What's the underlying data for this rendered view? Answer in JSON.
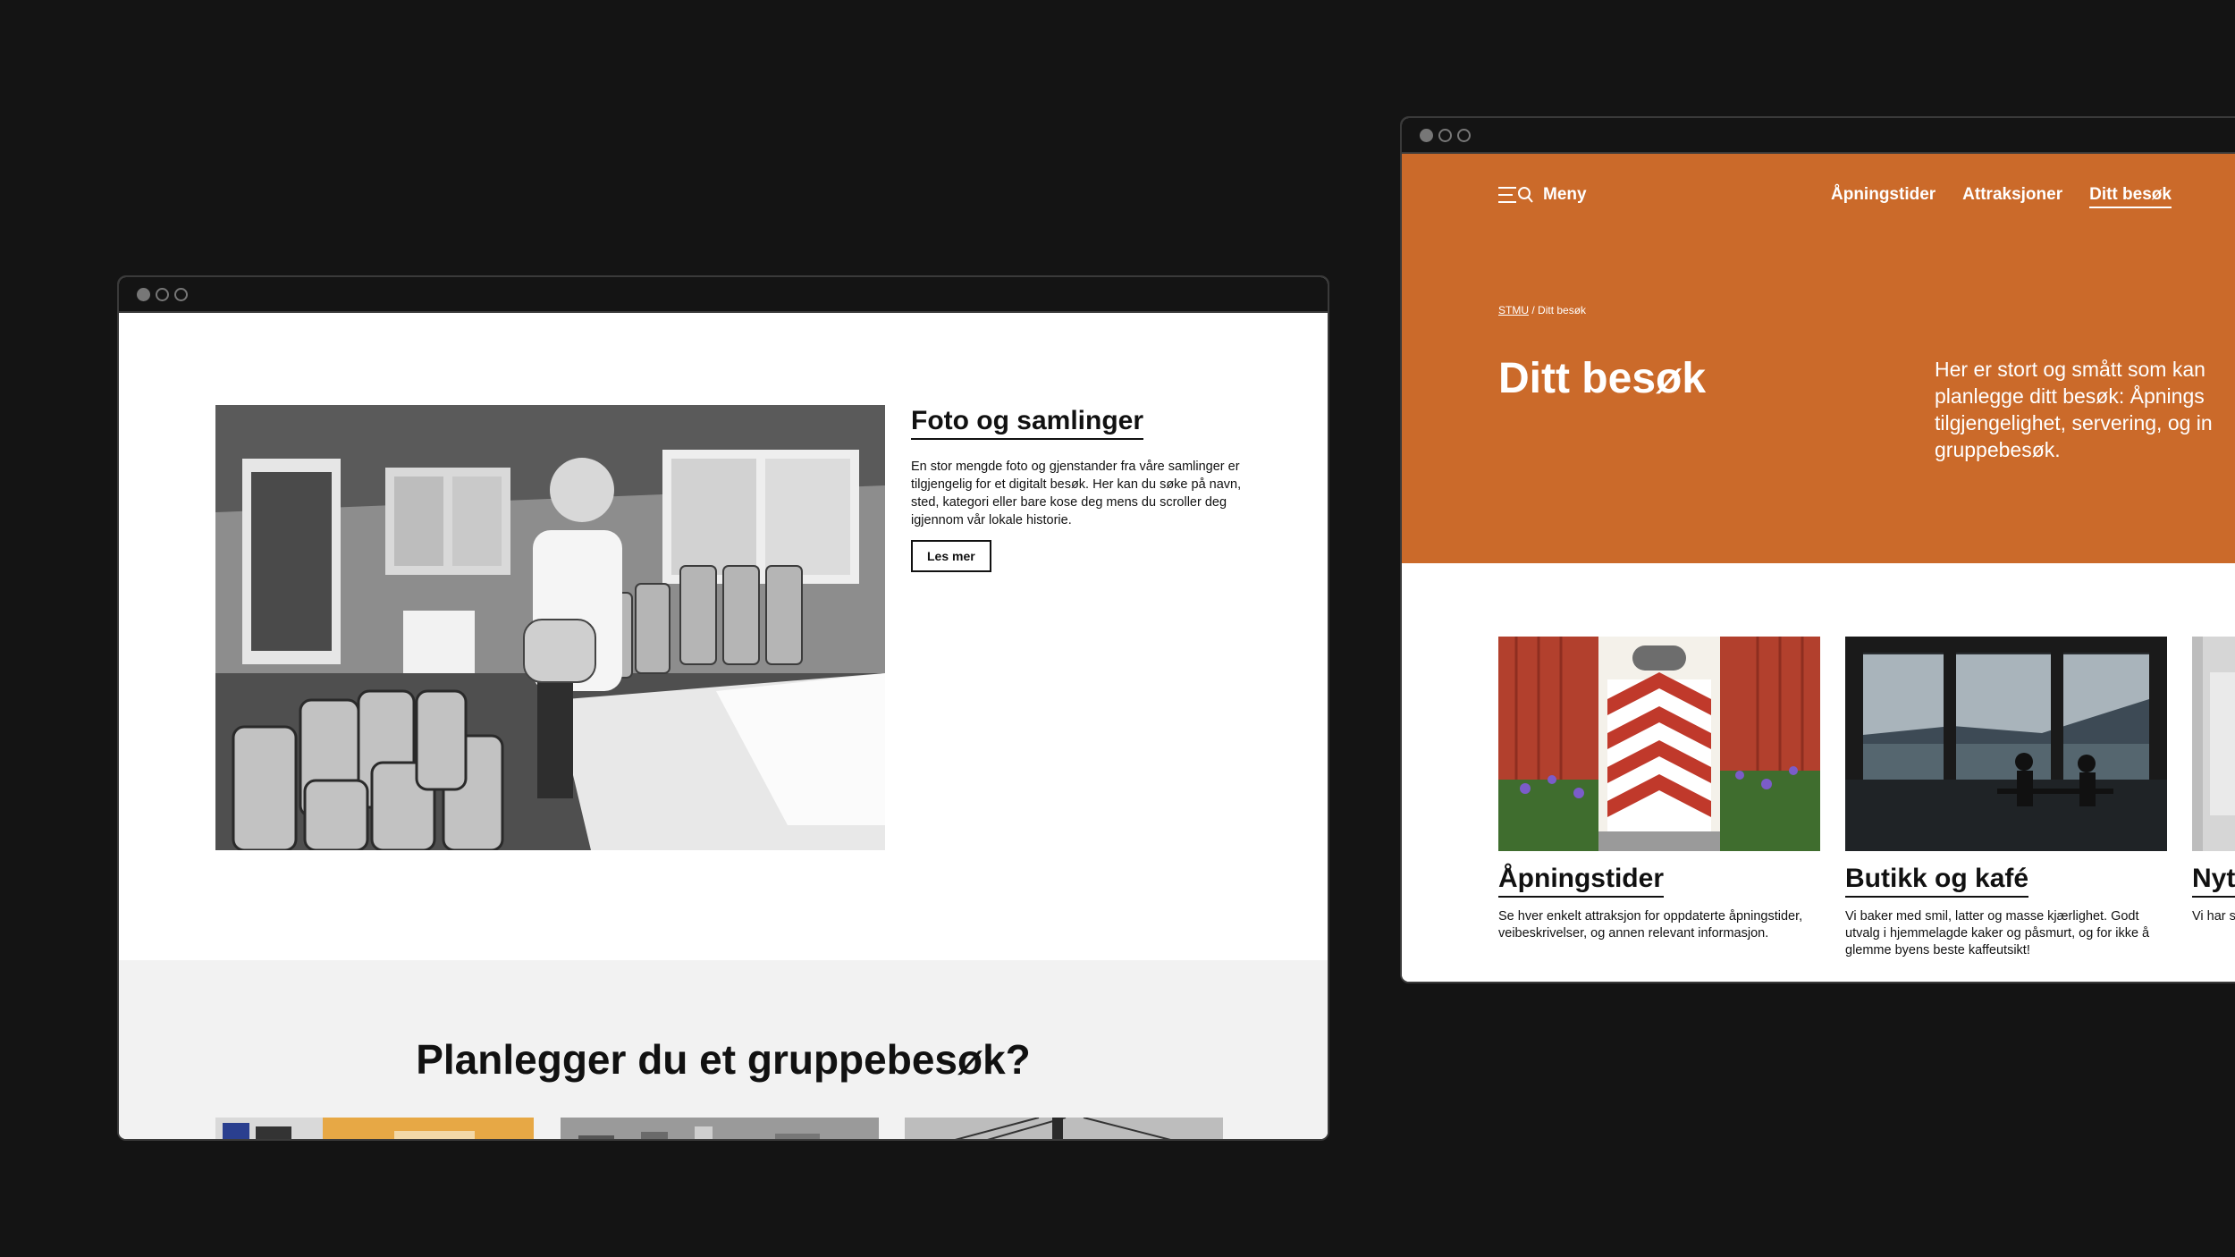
{
  "left_window": {
    "feature": {
      "title": "Foto og samlinger",
      "body": "En stor mengde foto og gjenstander fra våre samlinger er tilgjengelig for et digitalt besøk. Her kan du søke på navn, sted, kategori eller bare kose deg mens du scroller deg igjennom vår lokale historie.",
      "button_label": "Les mer"
    },
    "group_section": {
      "title": "Planlegger du et gruppebesøk?"
    }
  },
  "right_window": {
    "nav": {
      "menu_label": "Meny",
      "links": [
        "Åpningstider",
        "Attraksjoner",
        "Ditt besøk"
      ]
    },
    "breadcrumb": {
      "home": "STMU",
      "separator": "/",
      "current": "Ditt besøk"
    },
    "heading": "Ditt besøk",
    "intro_lines": [
      "Her er stort og smått som kan",
      "planlegge ditt besøk: Åpnings",
      "tilgjengelighet, servering, og in",
      "gruppebesøk."
    ],
    "cards": [
      {
        "title": "Åpningstider",
        "body": "Se hver enkelt attraksjon for oppdaterte åpningstider, veibeskrivelser, og annen relevant informasjon."
      },
      {
        "title": "Butikk og kafé",
        "body": "Vi baker med smil, latter og masse kjærlighet. Godt utvalg i hjemmelagde kaker og påsmurt, og for ikke å glemme byens beste kaffeutsikt!"
      },
      {
        "title": "Nyt",
        "body": "Vi har s spørsm"
      }
    ]
  },
  "colors": {
    "background": "#141414",
    "accent_orange": "#cb6a2a",
    "text": "#111111",
    "band_grey": "#f2f2f2"
  }
}
